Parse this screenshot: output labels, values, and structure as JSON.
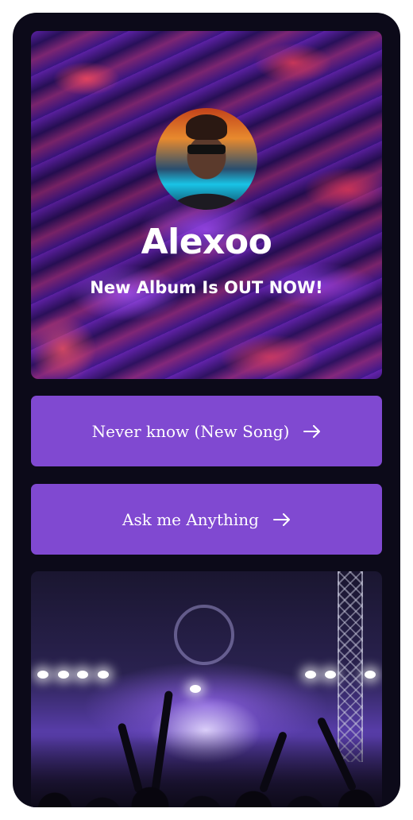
{
  "profile": {
    "name": "Alexoo",
    "tagline": "New Album Is OUT NOW!"
  },
  "links": [
    {
      "label": "Never know (New Song)",
      "icon": "arrow-right-icon"
    },
    {
      "label": "Ask me Anything",
      "icon": "arrow-right-icon"
    }
  ],
  "colors": {
    "background": "#0c0a19",
    "button": "#8049d1",
    "text": "#ffffff"
  }
}
